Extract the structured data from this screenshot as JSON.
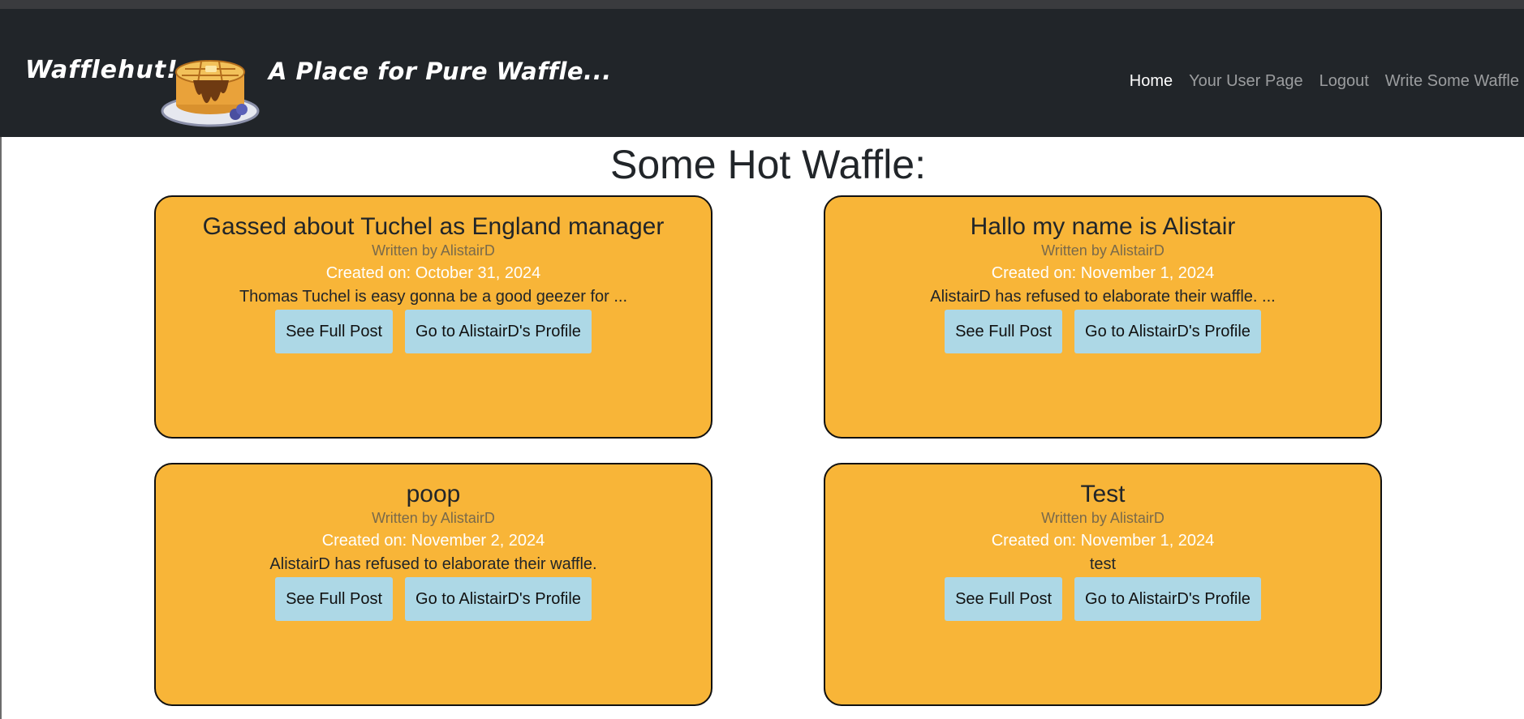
{
  "header": {
    "brand": "Wafflehut!",
    "tagline": "A Place for Pure Waffle...",
    "nav": [
      {
        "label": "Home",
        "active": true
      },
      {
        "label": "Your User Page",
        "active": false
      },
      {
        "label": "Logout",
        "active": false
      },
      {
        "label": "Write Some Waffle",
        "active": false
      }
    ]
  },
  "main": {
    "title": "Some Hot Waffle:",
    "posts": [
      {
        "title": "Gassed about Tuchel as England manager",
        "author": "Written by AlistairD",
        "created": "Created on: October 31, 2024",
        "excerpt": "Thomas Tuchel is easy gonna be a good geezer for ...",
        "see_label": "See Full Post",
        "profile_label": "Go to AlistairD's Profile"
      },
      {
        "title": "Hallo my name is Alistair",
        "author": "Written by AlistairD",
        "created": "Created on: November 1, 2024",
        "excerpt": "AlistairD has refused to elaborate their waffle. ...",
        "see_label": "See Full Post",
        "profile_label": "Go to AlistairD's Profile"
      },
      {
        "title": "poop",
        "author": "Written by AlistairD",
        "created": "Created on: November 2, 2024",
        "excerpt": "AlistairD has refused to elaborate their waffle.",
        "see_label": "See Full Post",
        "profile_label": "Go to AlistairD's Profile"
      },
      {
        "title": "Test",
        "author": "Written by AlistairD",
        "created": "Created on: November 1, 2024",
        "excerpt": "test",
        "see_label": "See Full Post",
        "profile_label": "Go to AlistairD's Profile"
      }
    ]
  },
  "colors": {
    "navbar": "#212529",
    "card": "#f8b538",
    "button": "#add8e6"
  },
  "icons": {
    "logo": "waffle-stack-logo"
  }
}
